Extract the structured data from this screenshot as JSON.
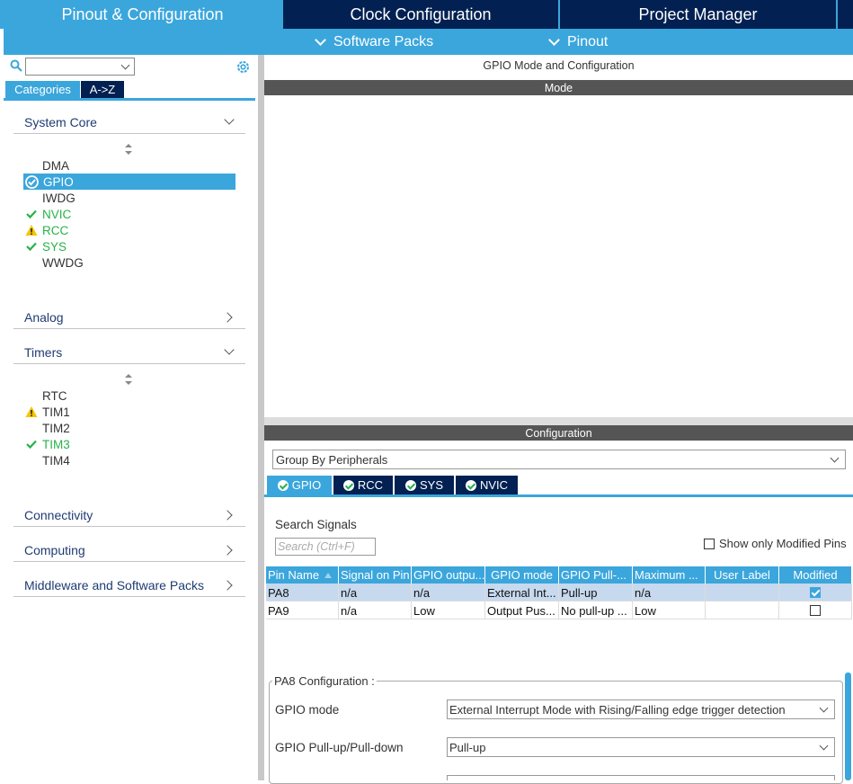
{
  "top_tabs": {
    "pinout": "Pinout & Configuration",
    "clock": "Clock Configuration",
    "project": "Project Manager"
  },
  "sub_menu": {
    "software_packs": "Software Packs",
    "pinout": "Pinout"
  },
  "sidebar": {
    "search_value": "",
    "tabs": {
      "categories": "Categories",
      "az": "A->Z"
    },
    "sections": {
      "system_core": "System Core",
      "analog": "Analog",
      "timers": "Timers",
      "connectivity": "Connectivity",
      "computing": "Computing",
      "middleware": "Middleware and Software Packs"
    },
    "system_core_items": [
      {
        "label": "DMA",
        "status": "none"
      },
      {
        "label": "GPIO",
        "status": "ok-selected"
      },
      {
        "label": "IWDG",
        "status": "none"
      },
      {
        "label": "NVIC",
        "status": "ok"
      },
      {
        "label": "RCC",
        "status": "warning"
      },
      {
        "label": "SYS",
        "status": "ok"
      },
      {
        "label": "WWDG",
        "status": "none"
      }
    ],
    "timer_items": [
      {
        "label": "RTC",
        "status": "none"
      },
      {
        "label": "TIM1",
        "status": "warning"
      },
      {
        "label": "TIM2",
        "status": "none"
      },
      {
        "label": "TIM3",
        "status": "ok"
      },
      {
        "label": "TIM4",
        "status": "none"
      }
    ]
  },
  "main": {
    "title": "GPIO Mode and Configuration",
    "mode_header": "Mode",
    "config_header": "Configuration",
    "group_by": "Group By Peripherals",
    "config_tabs": [
      "GPIO",
      "RCC",
      "SYS",
      "NVIC"
    ],
    "search_signals_label": "Search Signals",
    "search_placeholder": "Search (Ctrl+F)",
    "show_modified_label": "Show only Modified Pins",
    "table": {
      "columns": [
        "Pin Name",
        "Signal on Pin",
        "GPIO outpu...",
        "GPIO mode",
        "GPIO Pull-...",
        "Maximum ...",
        "User Label",
        "Modified"
      ],
      "rows": [
        {
          "pin": "PA8",
          "signal": "n/a",
          "output": "n/a",
          "mode": "External Int...",
          "pull": "Pull-up",
          "max": "n/a",
          "user_label": "",
          "modified": true
        },
        {
          "pin": "PA9",
          "signal": "n/a",
          "output": "Low",
          "mode": "Output Pus...",
          "pull": "No pull-up ...",
          "max": "Low",
          "user_label": "",
          "modified": false
        }
      ]
    },
    "pa8_config": {
      "legend": "PA8 Configuration :",
      "gpio_mode_label": "GPIO mode",
      "gpio_mode_value": "External Interrupt Mode with Rising/Falling edge trigger detection",
      "pull_label": "GPIO Pull-up/Pull-down",
      "pull_value": "Pull-up"
    }
  },
  "colors": {
    "accent": "#3ba6dc",
    "dark": "#022152",
    "ok": "#27b24a",
    "warning": "#f5c400"
  }
}
